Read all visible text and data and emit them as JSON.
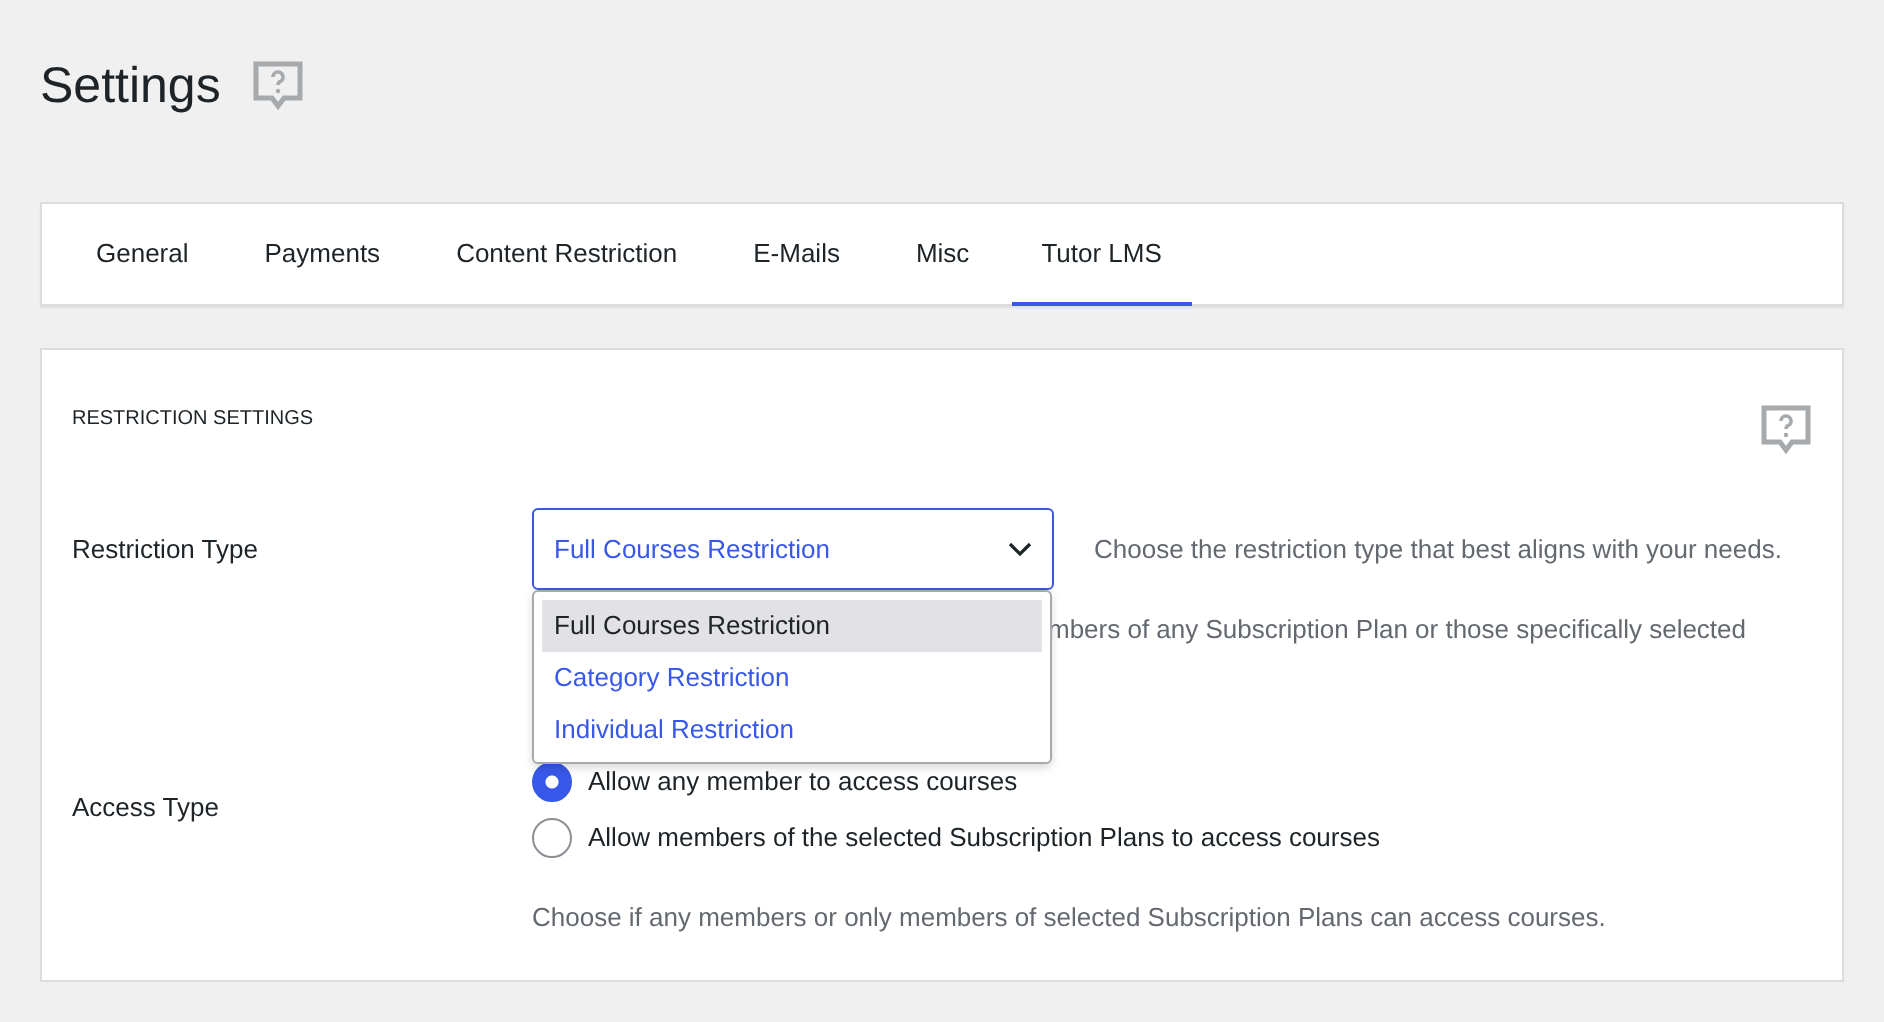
{
  "page_title": "Settings",
  "tabs": [
    {
      "label": "General",
      "selected": false
    },
    {
      "label": "Payments",
      "selected": false
    },
    {
      "label": "Content Restriction",
      "selected": false
    },
    {
      "label": "E-Mails",
      "selected": false
    },
    {
      "label": "Misc",
      "selected": false
    },
    {
      "label": "Tutor LMS",
      "selected": true
    }
  ],
  "section_title": "RESTRICTION SETTINGS",
  "restriction_type": {
    "label": "Restriction Type",
    "select": {
      "value": "Full Courses Restriction",
      "expanded": true,
      "options": [
        {
          "label": "Full Courses Restriction",
          "selected": true
        },
        {
          "label": "Category Restriction",
          "selected": false
        },
        {
          "label": "Individual Restriction",
          "selected": false
        }
      ]
    },
    "hint": "Choose the restriction type that best aligns with your needs.",
    "description": "mbers of any Subscription Plan or those specifically selected"
  },
  "access_type": {
    "label": "Access Type",
    "options": [
      {
        "label": "Allow any member to access courses",
        "selected": true
      },
      {
        "label": "Allow members of the selected Subscription Plans to access courses",
        "selected": false
      }
    ],
    "description": "Choose if any members or only members of selected Subscription Plans can access courses."
  }
}
